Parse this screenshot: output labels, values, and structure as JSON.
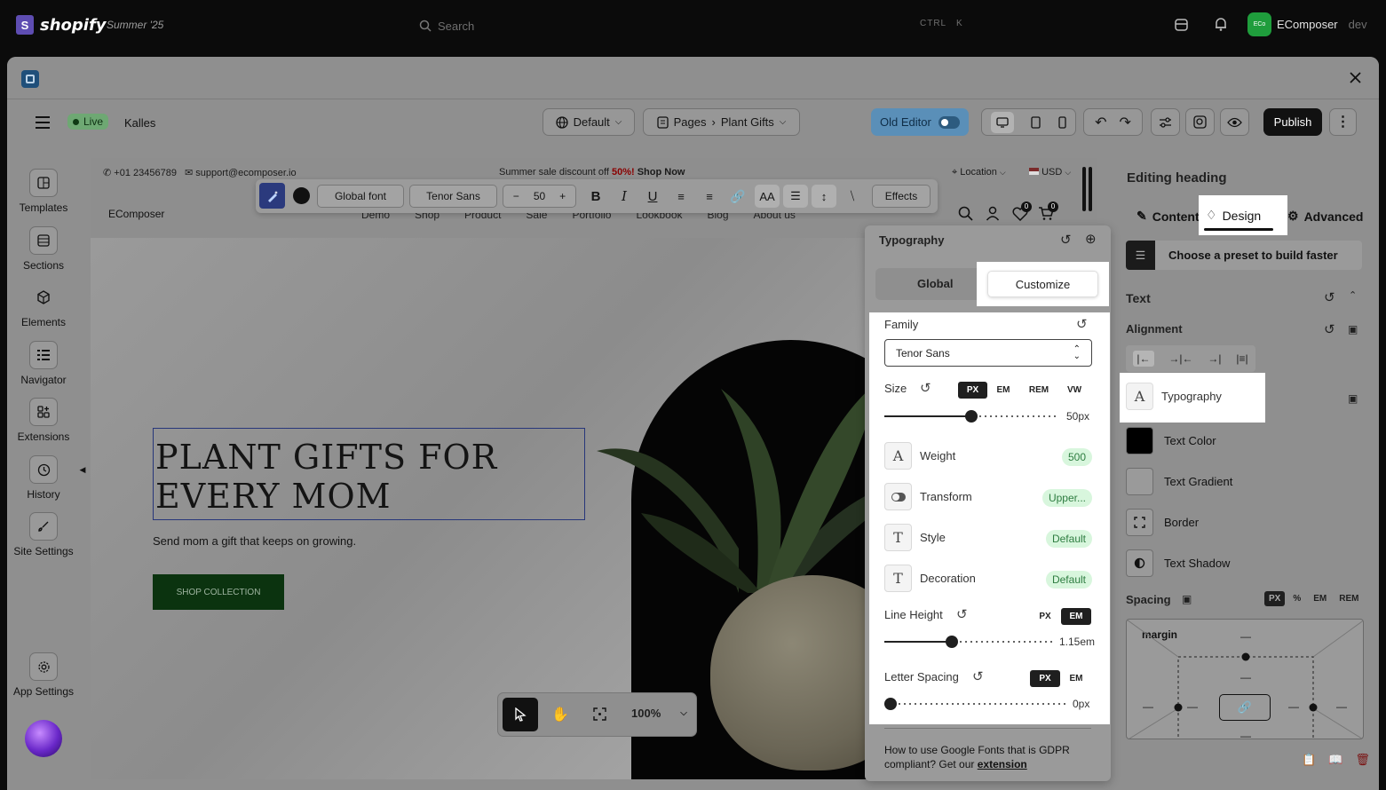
{
  "shopify": {
    "brand": "shopify",
    "season": "Summer '25",
    "search_placeholder": "Search",
    "kbd_ctrl": "CTRL",
    "kbd_k": "K",
    "store_avatar": "ECo",
    "store_name": "EComposer",
    "store_env": "dev"
  },
  "toolbar": {
    "live": "Live",
    "theme": "Kalles",
    "template": "Default",
    "pages": "Pages",
    "page": "Plant Gifts",
    "old_editor": "Old Editor",
    "publish": "Publish"
  },
  "leftbar": {
    "items": [
      {
        "label": "Templates"
      },
      {
        "label": "Sections"
      },
      {
        "label": "Elements"
      },
      {
        "label": "Navigator"
      },
      {
        "label": "Extensions"
      },
      {
        "label": "History"
      },
      {
        "label": "Site Settings"
      }
    ],
    "app_settings": "App Settings"
  },
  "canvas": {
    "phone": "+01 23456789",
    "email": "support@ecomposer.io",
    "announce_pre": "Summer sale discount off ",
    "announce_pct": "50%!",
    "announce_link": " Shop Now",
    "location": "Location",
    "currency": "USD",
    "site_logo": "EComposer",
    "nav": [
      "Demo",
      "Shop",
      "Product",
      "Sale",
      "Portfolio",
      "Lookbook",
      "Blog",
      "About us"
    ],
    "wishlist_count": "0",
    "cart_count": "0",
    "heading_line1": "PLANT GIFTS FOR",
    "heading_line2": "EVERY MOM",
    "subheading": "Send mom a gift that keeps on growing.",
    "cta": "SHOP COLLECTION"
  },
  "text_toolbar": {
    "global_font": "Global font",
    "font": "Tenor Sans",
    "size": "50",
    "effects": "Effects"
  },
  "zoom": {
    "value": "100%"
  },
  "right_panel": {
    "title": "Editing heading",
    "tabs": [
      "Content",
      "Design",
      "Advanced"
    ],
    "preset": "Choose a preset to build faster",
    "text_section": "Text",
    "alignment": "Alignment",
    "rows": [
      "Typography",
      "Text Color",
      "Text Gradient",
      "Border",
      "Text Shadow"
    ],
    "spacing": "Spacing",
    "spacing_units": [
      "PX",
      "%",
      "EM",
      "REM"
    ],
    "margin": "margin",
    "dash": "—"
  },
  "typography": {
    "title": "Typography",
    "tabs": [
      "Global",
      "Customize"
    ],
    "family_label": "Family",
    "family_value": "Tenor Sans",
    "size_label": "Size",
    "size_units": [
      "PX",
      "EM",
      "REM",
      "VW"
    ],
    "size_value": "50px",
    "size_fraction": 0.5,
    "weight_label": "Weight",
    "weight_value": "500",
    "transform_label": "Transform",
    "transform_value": "Upper...",
    "style_label": "Style",
    "style_value": "Default",
    "decoration_label": "Decoration",
    "decoration_value": "Default",
    "lineheight_label": "Line Height",
    "lineheight_units": [
      "PX",
      "EM"
    ],
    "lineheight_value": "1.15em",
    "lineheight_fraction": 0.39,
    "letterspacing_label": "Letter Spacing",
    "letterspacing_units": [
      "PX",
      "EM"
    ],
    "letterspacing_value": "0px",
    "letterspacing_fraction": 0,
    "footer_text": "How to use Google Fonts that is GDPR compliant? Get our ",
    "footer_link": "extension"
  }
}
